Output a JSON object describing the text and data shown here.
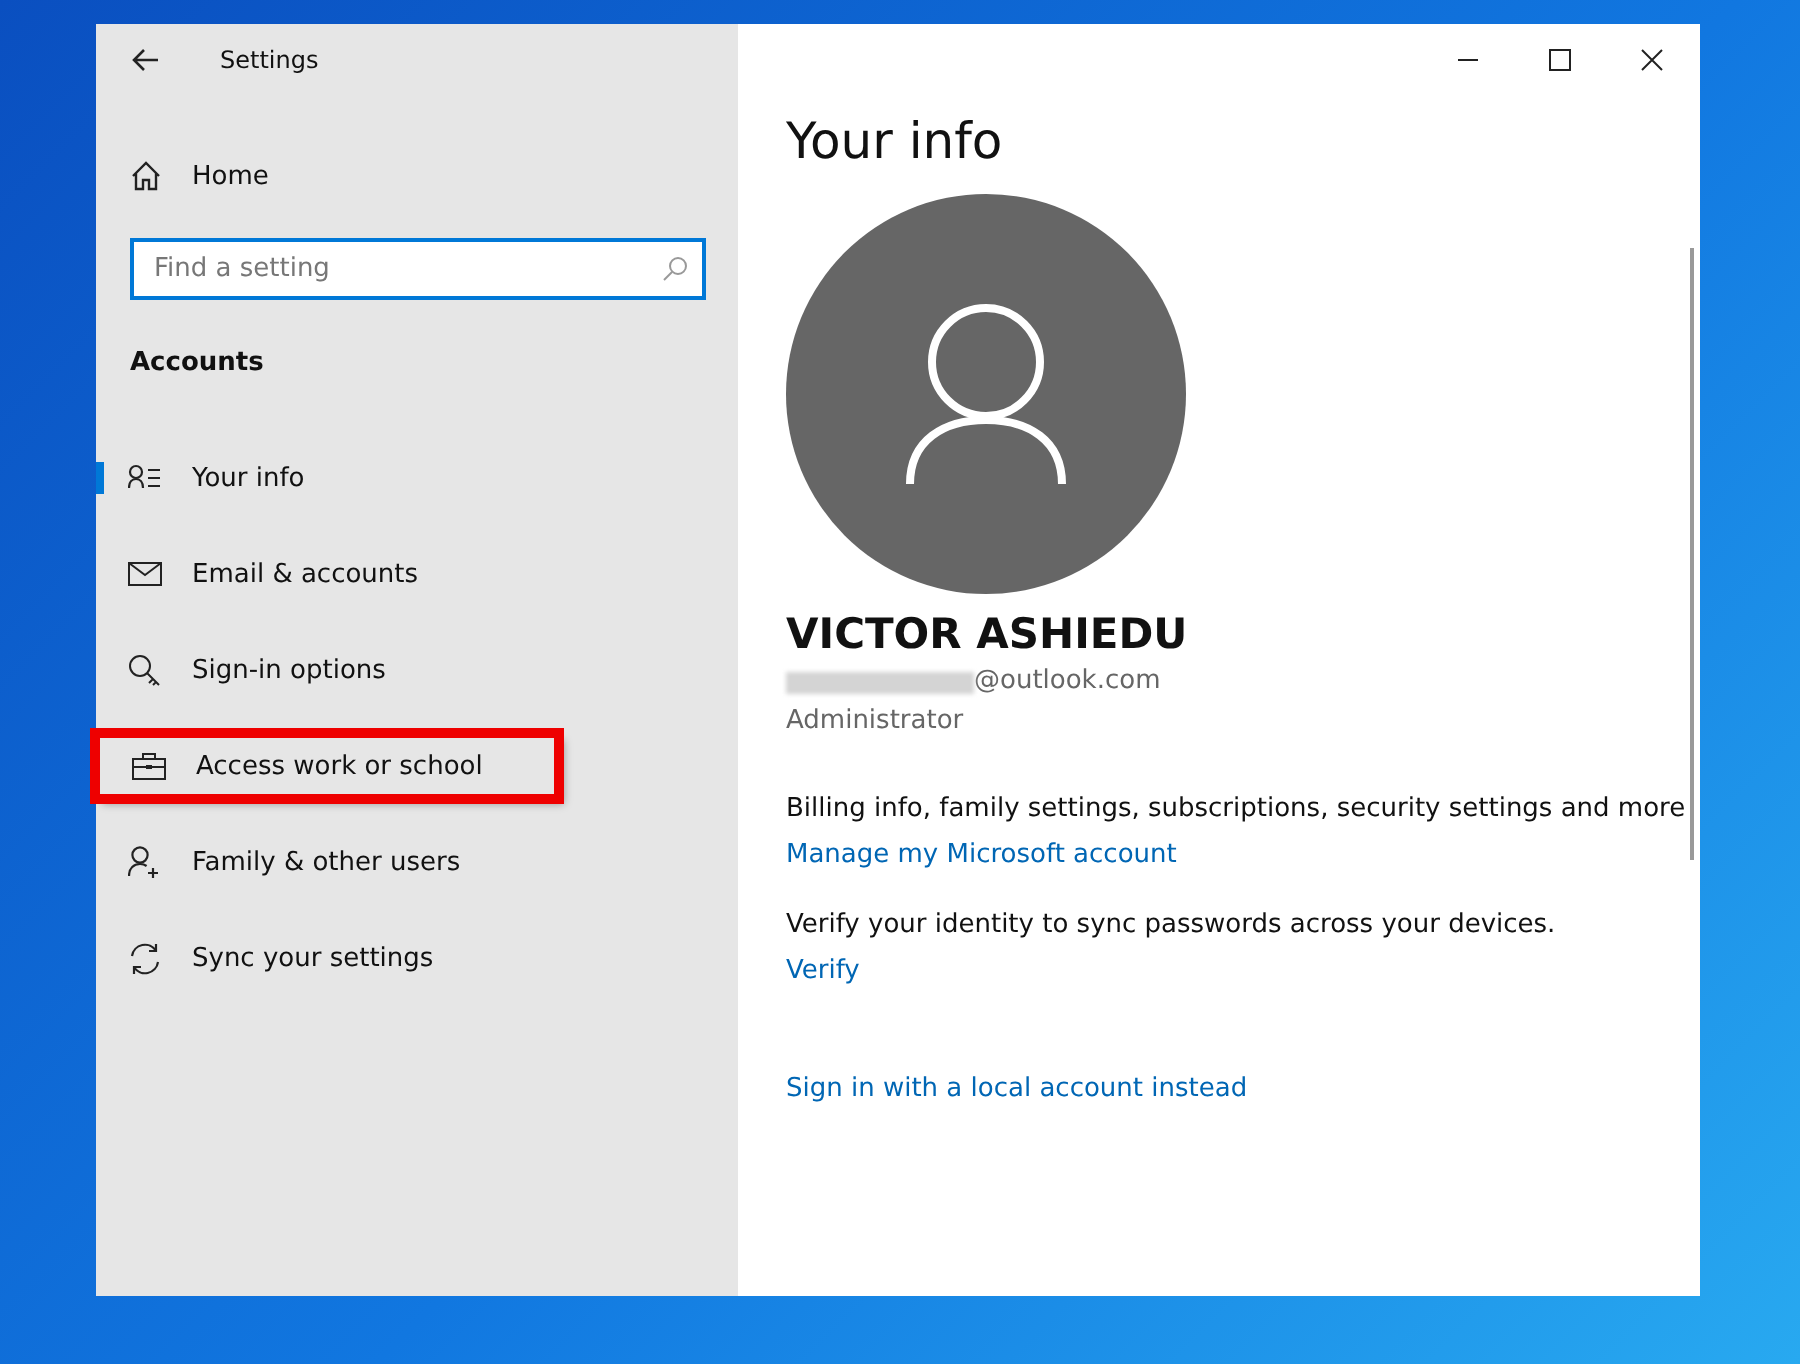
{
  "window": {
    "title": "Settings"
  },
  "sidebar": {
    "home": "Home",
    "search": {
      "placeholder": "Find a setting"
    },
    "section": "Accounts",
    "items": [
      {
        "label": "Your info",
        "selected": true,
        "highlighted": false
      },
      {
        "label": "Email & accounts",
        "selected": false,
        "highlighted": false
      },
      {
        "label": "Sign-in options",
        "selected": false,
        "highlighted": false
      },
      {
        "label": "Access work or school",
        "selected": false,
        "highlighted": true
      },
      {
        "label": "Family & other users",
        "selected": false,
        "highlighted": false
      },
      {
        "label": "Sync your settings",
        "selected": false,
        "highlighted": false
      }
    ]
  },
  "main": {
    "title": "Your info",
    "name": "VICTOR ASHIEDU",
    "email": "@outlook.com",
    "role": "Administrator",
    "sections": [
      {
        "text": "Billing info, family settings, subscriptions, security settings and more",
        "link": "Manage my Microsoft account"
      },
      {
        "text": "Verify your identity to sync passwords across your devices.",
        "link": "Verify"
      }
    ],
    "footer_link": "Sign in with a local account instead"
  }
}
